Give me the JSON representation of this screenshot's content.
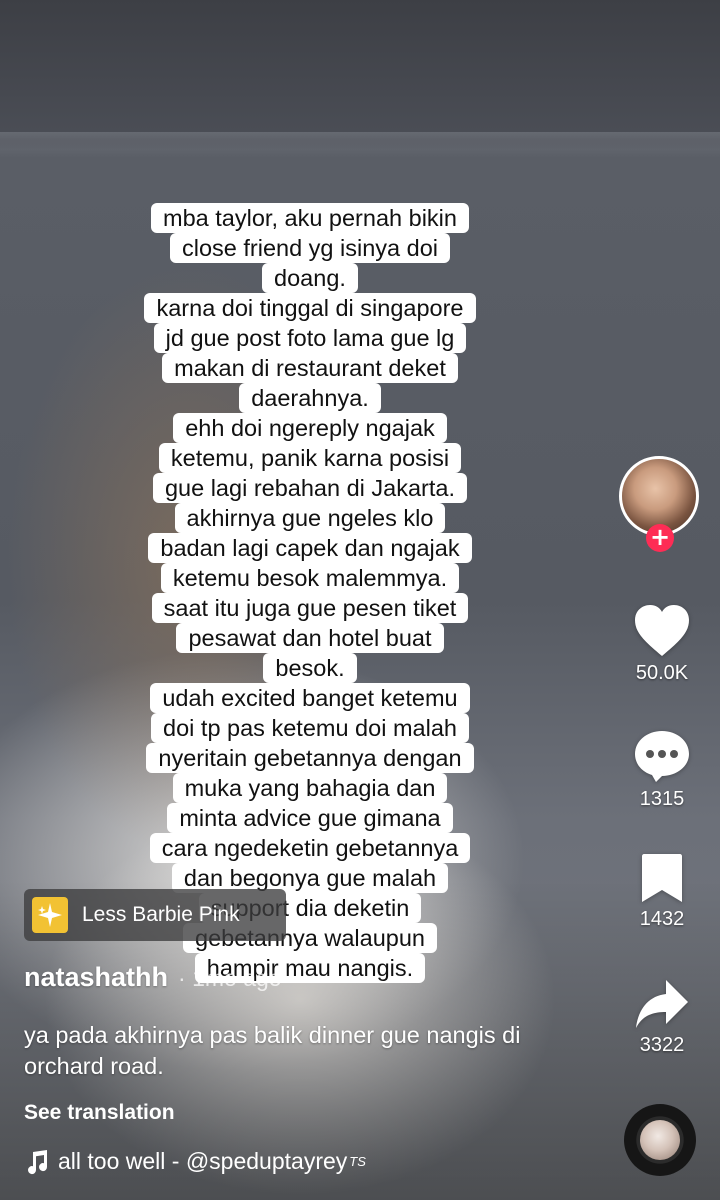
{
  "video": {
    "caption_lines": [
      "mba taylor, aku pernah bikin",
      "close friend yg isinya doi",
      "doang.",
      "karna doi tinggal di singapore",
      "jd gue post foto lama gue lg",
      "makan di restaurant deket",
      "daerahnya.",
      "ehh doi ngereply ngajak",
      "ketemu, panik karna posisi",
      "gue lagi rebahan di Jakarta.",
      "akhirnya gue ngeles klo",
      "badan lagi capek dan ngajak",
      "ketemu besok malemmya.",
      "saat itu juga gue pesen tiket",
      "pesawat dan hotel buat",
      "besok.",
      "udah excited banget ketemu",
      "doi tp pas ketemu doi malah",
      "nyeritain gebetannya dengan",
      "muka yang bahagia dan",
      "minta advice gue gimana",
      "cara ngedeketin gebetannya",
      "dan begonya gue malah",
      "support dia deketin",
      "gebetannya walaupun",
      "hampir mau nangis."
    ]
  },
  "rail": {
    "avatar_icon": "creator-avatar",
    "follow_icon": "plus-icon",
    "likes": "50.0K",
    "comments": "1315",
    "saves": "1432",
    "shares": "3322",
    "like_color": "#ffffff"
  },
  "effect": {
    "label": "Less Barbie Pink",
    "icon": "sparkle-icon",
    "icon_bg": "#f2c233"
  },
  "post": {
    "username": "natashathh",
    "time": "· 1mo ago",
    "description": "ya pada akhirnya pas balik dinner gue nangis di orchard road.",
    "see_translation": "See translation"
  },
  "music": {
    "icon": "music-note-icon",
    "text": "all too well - @speduptayrey",
    "badge": "TS"
  },
  "colors": {
    "follow": "#fe2c55",
    "caption_bg": "#ffffff",
    "text": "#ffffff"
  }
}
